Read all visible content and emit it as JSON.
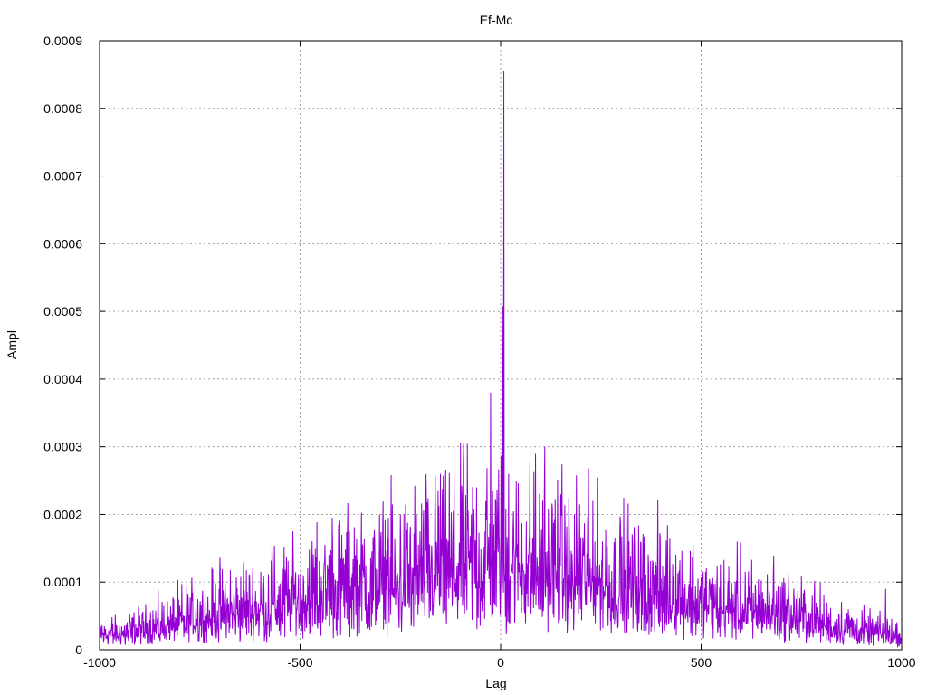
{
  "chart_data": {
    "type": "line",
    "title": "Ef-Mc",
    "xlabel": "Lag",
    "ylabel": "Ampl",
    "xlim": [
      -1000,
      1000
    ],
    "ylim": [
      0,
      0.0009
    ],
    "grid": true,
    "line_color": "#9400d3",
    "x_ticks": [
      {
        "value": -1000,
        "label": "-1000"
      },
      {
        "value": -500,
        "label": "-500"
      },
      {
        "value": 0,
        "label": "0"
      },
      {
        "value": 500,
        "label": "500"
      },
      {
        "value": 1000,
        "label": "1000"
      }
    ],
    "y_ticks": [
      {
        "value": 0,
        "label": "0"
      },
      {
        "value": 0.0001,
        "label": "0.0001"
      },
      {
        "value": 0.0002,
        "label": "0.0002"
      },
      {
        "value": 0.0003,
        "label": "0.0003"
      },
      {
        "value": 0.0004,
        "label": "0.0004"
      },
      {
        "value": 0.0005,
        "label": "0.0005"
      },
      {
        "value": 0.0006,
        "label": "0.0006"
      },
      {
        "value": 0.0007,
        "label": "0.0007"
      },
      {
        "value": 0.0008,
        "label": "0.0008"
      },
      {
        "value": 0.0009,
        "label": "0.0009"
      }
    ],
    "envelope": [
      {
        "x": -1000,
        "y": 3e-05
      },
      {
        "x": -900,
        "y": 4e-05
      },
      {
        "x": -800,
        "y": 6e-05
      },
      {
        "x": -700,
        "y": 8e-05
      },
      {
        "x": -600,
        "y": 9e-05
      },
      {
        "x": -500,
        "y": 0.00011
      },
      {
        "x": -400,
        "y": 0.00013
      },
      {
        "x": -300,
        "y": 0.00014
      },
      {
        "x": -200,
        "y": 0.00016
      },
      {
        "x": -100,
        "y": 0.00018
      },
      {
        "x": 0,
        "y": 0.0002
      },
      {
        "x": 100,
        "y": 0.00018
      },
      {
        "x": 200,
        "y": 0.00016
      },
      {
        "x": 300,
        "y": 0.00014
      },
      {
        "x": 400,
        "y": 0.00012
      },
      {
        "x": 500,
        "y": 0.0001
      },
      {
        "x": 600,
        "y": 9e-05
      },
      {
        "x": 700,
        "y": 8e-05
      },
      {
        "x": 800,
        "y": 6e-05
      },
      {
        "x": 900,
        "y": 4e-05
      },
      {
        "x": 1000,
        "y": 3e-05
      }
    ],
    "peaks": [
      {
        "x": 8,
        "y": 0.000855
      },
      {
        "x": 5,
        "y": 0.000508
      },
      {
        "x": -25,
        "y": 0.00038
      },
      {
        "x": 110,
        "y": 0.0003
      },
      {
        "x": -150,
        "y": 0.00026
      },
      {
        "x": 20,
        "y": 0.00026
      },
      {
        "x": 230,
        "y": 0.00022
      },
      {
        "x": -280,
        "y": 0.000195
      },
      {
        "x": -420,
        "y": 0.000195
      },
      {
        "x": -570,
        "y": 0.000155
      },
      {
        "x": 480,
        "y": 0.000155
      },
      {
        "x": 680,
        "y": 0.00011
      },
      {
        "x": 960,
        "y": 9e-05
      }
    ]
  }
}
